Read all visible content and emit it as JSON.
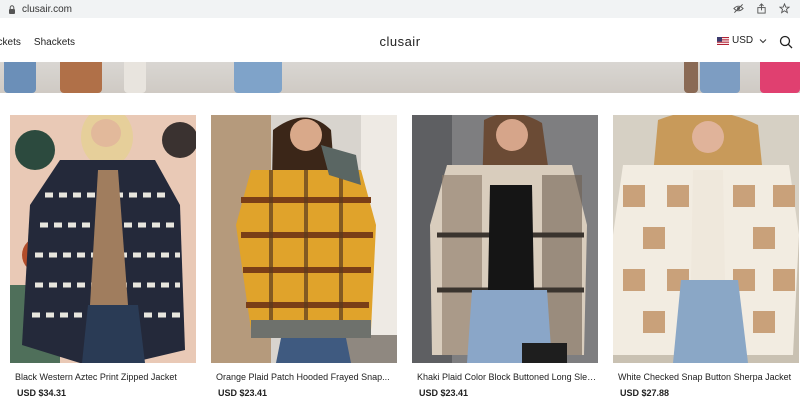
{
  "browser": {
    "url": "clusair.com",
    "icons": [
      "lock-icon",
      "eye-off-icon",
      "share-icon",
      "star-icon"
    ]
  },
  "header": {
    "nav": [
      {
        "label": "ackets"
      },
      {
        "label": "Shackets"
      }
    ],
    "brand": "clusair",
    "currency": "USD",
    "icons": [
      "us-flag-icon",
      "chevron-down-icon",
      "search-icon"
    ]
  },
  "products": [
    {
      "title": "Black Western Aztec Print Zipped Jacket",
      "price": "USD $34.31"
    },
    {
      "title": "Orange Plaid Patch Hooded Frayed Snap...",
      "price": "USD $23.41"
    },
    {
      "title": "Khaki Plaid Color Block Buttoned Long Slee...",
      "price": "USD $23.41"
    },
    {
      "title": "White Checked Snap Button Sherpa Jacket",
      "price": "USD $27.88"
    }
  ],
  "colors": {
    "browser_bar": "#f1f3f4",
    "text": "#222222",
    "background": "#ffffff"
  }
}
